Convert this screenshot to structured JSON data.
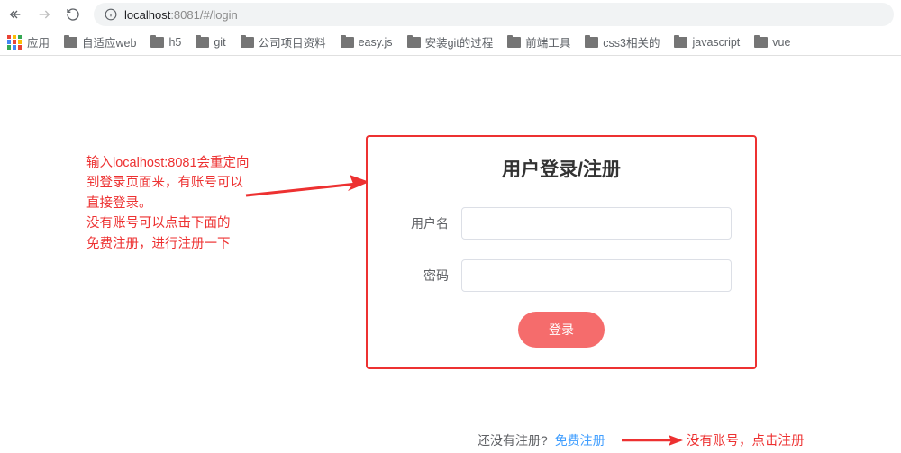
{
  "browser": {
    "url_host": "localhost",
    "url_port": ":8081",
    "url_path": "/#/login"
  },
  "bookmarks": {
    "apps_label": "应用",
    "items": [
      "自适应web",
      "h5",
      "git",
      "公司项目资料",
      "easy.js",
      "安装git的过程",
      "前端工具",
      "css3相关的",
      "javascript",
      "vue"
    ]
  },
  "annotation_left": {
    "l1": "输入localhost:8081会重定向",
    "l2": "到登录页面来，有账号可以",
    "l3": "直接登录。",
    "l4": "没有账号可以点击下面的",
    "l5": "免费注册，进行注册一下"
  },
  "form": {
    "title": "用户登录/注册",
    "username_label": "用户名",
    "password_label": "密码",
    "login_button": "登录"
  },
  "register": {
    "prompt": "还没有注册?",
    "link": "免费注册"
  },
  "annotation_right": "没有账号，点击注册"
}
